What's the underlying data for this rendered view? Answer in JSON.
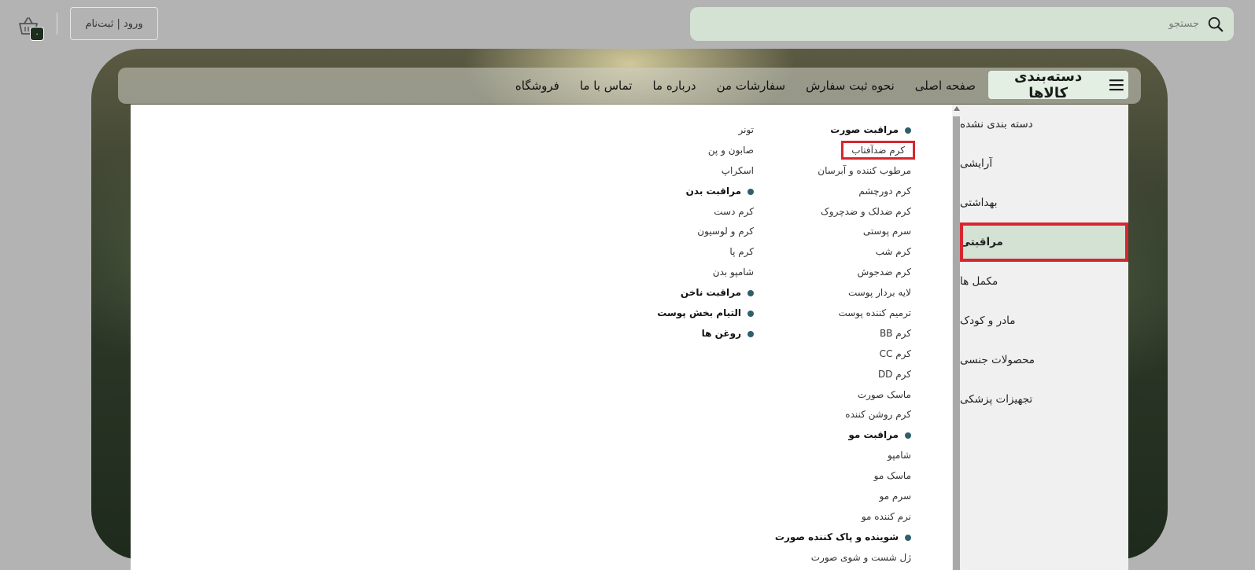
{
  "header": {
    "search_placeholder": "جستجو",
    "login_label": "ورود | ثبت‌نام",
    "cart_count": "۰"
  },
  "nav": {
    "category_button": "دسته‌بندی کالاها",
    "links": [
      "صفحه اصلی",
      "نحوه ثبت سفارش",
      "سفارشات من",
      "درباره ما",
      "تماس با ما",
      "فروشگاه"
    ]
  },
  "categories": [
    "دسته بندی نشده",
    "آرایشی",
    "بهداشتی",
    "مراقبتی",
    "مکمل ها",
    "مادر و کودک",
    "محصولات جنسی",
    "تجهیزات پزشکی"
  ],
  "menu_col_a": [
    "مراقبت صورت",
    "کرم ضدآفتاب",
    "مرطوب کننده و آبرسان",
    "کرم دورچشم",
    "کرم ضدلک و ضدچروک",
    "سرم پوستی",
    "کرم شب",
    "کرم ضدجوش",
    "لایه بردار پوست",
    "ترمیم کننده پوست",
    "کرم BB",
    "کرم CC",
    "کرم DD",
    "ماسک صورت",
    "کرم روشن کننده",
    "مراقبت مو",
    "شامپو",
    "ماسک مو",
    "سرم مو",
    "نرم کننده مو",
    "شوینده و پاک کننده صورت",
    "ژل شست و شوی صورت"
  ],
  "menu_col_b": [
    "تونر",
    "صابون و پن",
    "اسکراپ",
    "مراقبت بدن",
    "کرم دست",
    "کرم و لوسیون",
    "کرم پا",
    "شامپو بدن",
    "مراقبت ناخن",
    "التیام بخش پوست",
    "روغن ها"
  ],
  "colors": {
    "accent_green": "#d3e2d3",
    "highlight_red": "#d7262f",
    "bullet": "#2e5f6d"
  }
}
